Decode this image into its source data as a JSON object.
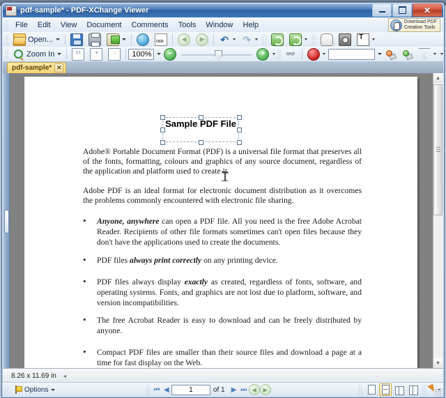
{
  "desktop": {
    "background_text": ""
  },
  "window": {
    "title": "pdf-sample* - PDF-XChange Viewer",
    "icon": "app-icon",
    "minimize_label": "—",
    "maximize_label": "□",
    "close_label": "✕"
  },
  "menubar": {
    "items": [
      "File",
      "Edit",
      "View",
      "Document",
      "Comments",
      "Tools",
      "Window",
      "Help"
    ],
    "download_badge": {
      "line1": "Download PDF",
      "line2": "Creation Tools"
    }
  },
  "toolbar_row1": {
    "open_label": "Open...",
    "icons": [
      "open-folder-icon",
      "save-icon",
      "print-icon",
      "email-icon",
      "scan-icon",
      "ocr-icon",
      "back-icon",
      "forward-icon",
      "undo-icon",
      "redo-icon",
      "rotate-left-icon",
      "rotate-right-icon",
      "hand-tool-icon",
      "snapshot-icon",
      "select-text-icon"
    ]
  },
  "toolbar_row2": {
    "zoom_in_label": "Zoom In",
    "zoom_value": "100%",
    "search_value": "",
    "icons": [
      "zoom-in-icon",
      "actual-size-icon",
      "fit-page-icon",
      "fit-width-icon",
      "zoom-out-minus-icon",
      "zoom-slider",
      "zoom-in-plus-icon",
      "glasses-icon",
      "stamp-icon",
      "search-field",
      "add-note-icon",
      "add-comment-icon",
      "highlight-icon"
    ]
  },
  "tabs": [
    {
      "label": "pdf-sample*",
      "close_label": "✕",
      "active": true
    }
  ],
  "document": {
    "title": "Sample PDF File",
    "paragraph1": "Adobe® Portable Document Format (PDF) is a universal file format that preserves all of the fonts, formatting, colours and graphics of any source document, regardless of the application and platform used to create it.",
    "paragraph2": "Adobe PDF is an ideal format for electronic document distribution as it overcomes the problems commonly encountered with electronic file sharing.",
    "bullets": [
      {
        "emphasis": "Anyone, anywhere",
        "emphasis_position": "start",
        "text": " can open a PDF file. All you need is the free Adobe Acrobat Reader. Recipients of other file formats sometimes can't open files because they don't have the applications used to create the documents."
      },
      {
        "prefix": "PDF files ",
        "emphasis": "always print correctly",
        "text": " on any printing device."
      },
      {
        "prefix": "PDF files always display ",
        "emphasis": "exactly",
        "text": " as created, regardless of fonts, software, and operating systems. Fonts, and graphics are not lost due to platform, software, and version incompatibilities."
      },
      {
        "prefix": "",
        "emphasis": "",
        "text": "The free Acrobat Reader is easy to download and can be freely distributed by anyone."
      },
      {
        "prefix": "",
        "emphasis": "",
        "text": "Compact PDF files are smaller than their source files and download a page at a time for fast display on the Web."
      }
    ]
  },
  "sizebar": {
    "page_size": "8.26 x 11.69 in"
  },
  "statusbar": {
    "options_label": "Options",
    "first_page_icon": "first-page-icon",
    "prev_page_icon": "previous-page-icon",
    "page_number": "1",
    "page_total": "of 1",
    "next_page_icon": "next-page-icon",
    "last_page_icon": "last-page-icon",
    "back_view_icon": "previous-view-icon",
    "forward_view_icon": "next-view-icon",
    "view_modes": [
      "single-page",
      "continuous",
      "facing",
      "facing-continuous"
    ],
    "active_view_mode": "continuous"
  }
}
